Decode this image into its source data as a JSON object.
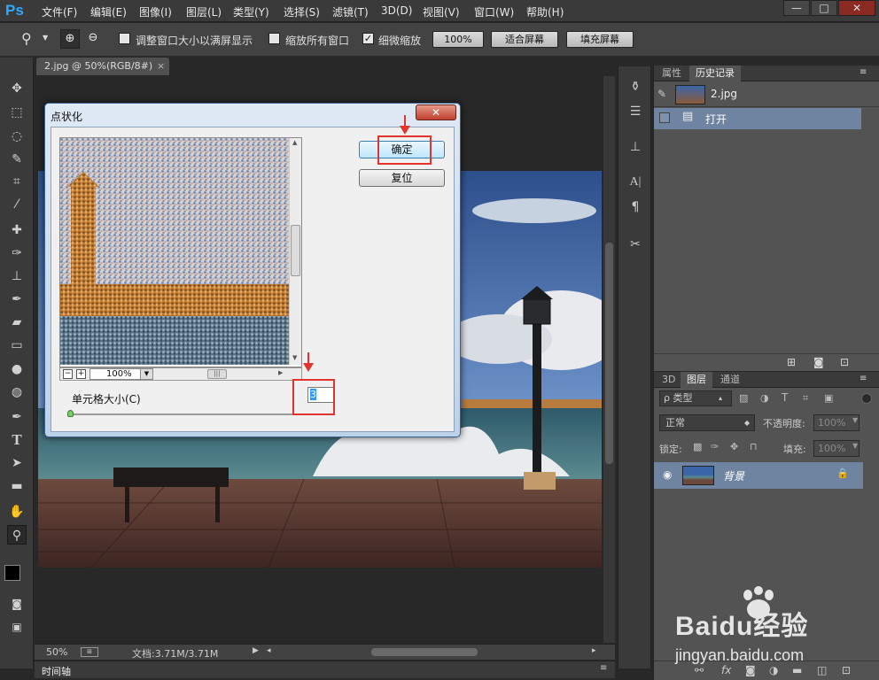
{
  "app": {
    "logo": "Ps"
  },
  "menu": [
    "文件(F)",
    "编辑(E)",
    "图像(I)",
    "图层(L)",
    "类型(Y)",
    "选择(S)",
    "滤镜(T)",
    "3D(D)",
    "视图(V)",
    "窗口(W)",
    "帮助(H)"
  ],
  "window_controls": {
    "minimize": "—",
    "restore": "□",
    "close": "✕"
  },
  "options": {
    "resize_windows_label": "调整窗口大小以满屏显示",
    "zoom_all_label": "缩放所有窗口",
    "scrubby_zoom_label": "细微缩放",
    "scrubby_checked": "✓",
    "zoom_value": "100%",
    "fit_screen": "适合屏幕",
    "fill_screen": "填充屏幕"
  },
  "document": {
    "tab_title": "2.jpg @ 50%(RGB/8#)",
    "tab_close": "×"
  },
  "status": {
    "zoom": "50%",
    "doc_size": "文档:3.71M/3.71M"
  },
  "bottom_panel": {
    "label": "时间轴"
  },
  "history_panel": {
    "tabs": [
      "属性",
      "历史记录"
    ],
    "snapshot_name": "2.jpg",
    "states": [
      "打开"
    ]
  },
  "layers_panel": {
    "tabs": [
      "3D",
      "图层",
      "通道"
    ],
    "filter_label": "ρ 类型",
    "blend_mode": "正常",
    "opacity_label": "不透明度:",
    "opacity_value": "100%",
    "lock_label": "锁定:",
    "fill_label": "填充:",
    "fill_value": "100%",
    "layers": [
      {
        "name": "背景"
      }
    ],
    "footer_icons": [
      "link-icon",
      "fx-icon",
      "mask-icon",
      "adjustment-icon",
      "folder-icon",
      "new-layer-icon",
      "trash-icon"
    ]
  },
  "dialog": {
    "title": "点状化",
    "ok": "确定",
    "reset": "复位",
    "zoom": "100%",
    "cell_size_label": "单元格大小(C)",
    "cell_size_value": "3"
  },
  "watermark": {
    "text": "Baidu经验",
    "url": "jingyan.baidu.com"
  }
}
